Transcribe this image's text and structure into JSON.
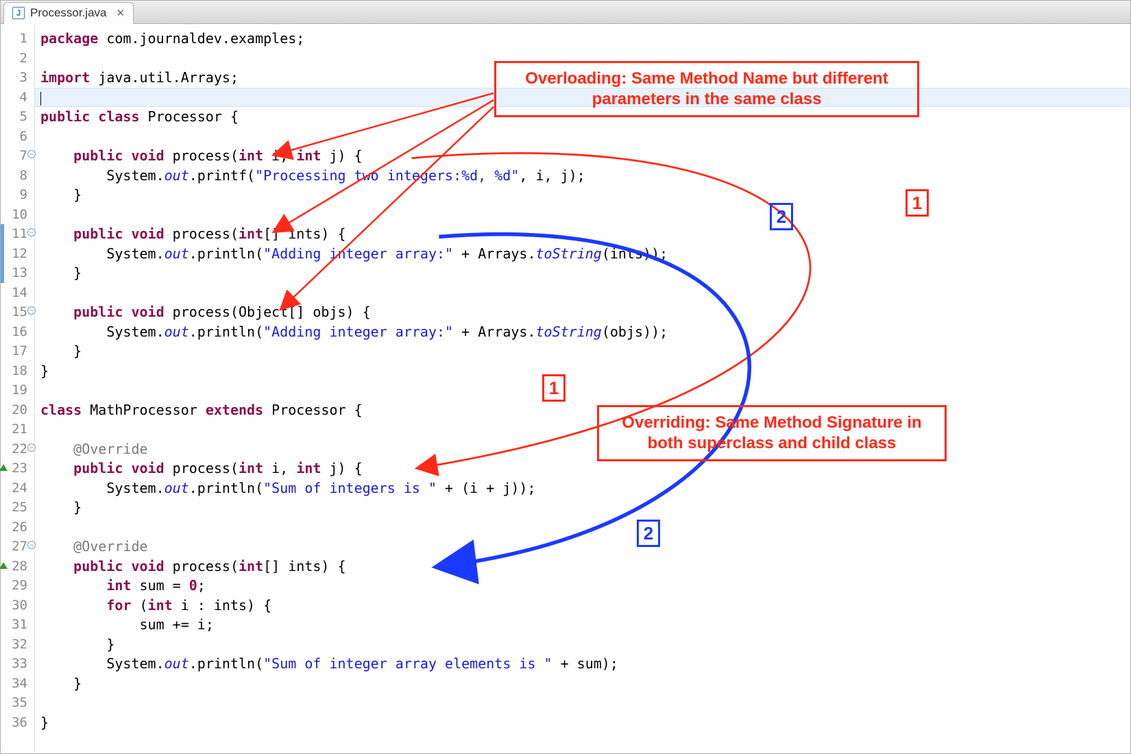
{
  "tab": {
    "filename": "Processor.java",
    "close_glyph": "✕",
    "java_letter": "J"
  },
  "annotations": {
    "overloading": "Overloading: Same Method Name but different\nparameters in the same class",
    "overriding": "Overriding: Same Method Signature in\nboth superclass and child class",
    "red1": "1",
    "red1b": "1",
    "blue2": "2",
    "blue2b": "2"
  },
  "gutter": {
    "line_count": 36,
    "foldable_lines": [
      7,
      11,
      15,
      22,
      27
    ],
    "override_marker_lines": [
      23,
      28
    ],
    "change_marker_lines": [
      11,
      12,
      13
    ],
    "highlighted_line": 4
  },
  "code": [
    {
      "n": 1,
      "h": "<span class='kw'>package</span> com.journaldev.examples;"
    },
    {
      "n": 2,
      "h": ""
    },
    {
      "n": 3,
      "h": "<span class='kw'>import</span> java.util.Arrays;"
    },
    {
      "n": 4,
      "h": "<span class='cur'></span>",
      "hl": true
    },
    {
      "n": 5,
      "h": "<span class='kw'>public</span> <span class='kw'>class</span> Processor {"
    },
    {
      "n": 6,
      "h": ""
    },
    {
      "n": 7,
      "h": "    <span class='kw'>public</span> <span class='kw'>void</span> process(<span class='kw'>int</span> i, <span class='kw'>int</span> j) {"
    },
    {
      "n": 8,
      "h": "        System.<span class='st'>out</span>.printf(<span class='str'>\"Processing two integers:%d, %d\"</span>, i, j);"
    },
    {
      "n": 9,
      "h": "    }"
    },
    {
      "n": 10,
      "h": ""
    },
    {
      "n": 11,
      "h": "    <span class='kw'>public</span> <span class='kw'>void</span> process(<span class='kw'>int</span>[] ints) {"
    },
    {
      "n": 12,
      "h": "        System.<span class='st'>out</span>.println(<span class='str'>\"Adding integer array:\"</span> + Arrays.<span class='st'>toString</span>(ints));"
    },
    {
      "n": 13,
      "h": "    }"
    },
    {
      "n": 14,
      "h": ""
    },
    {
      "n": 15,
      "h": "    <span class='kw'>public</span> <span class='kw'>void</span> process(Object[] objs) {"
    },
    {
      "n": 16,
      "h": "        System.<span class='st'>out</span>.println(<span class='str'>\"Adding integer array:\"</span> + Arrays.<span class='st'>toString</span>(objs));"
    },
    {
      "n": 17,
      "h": "    }"
    },
    {
      "n": 18,
      "h": "}"
    },
    {
      "n": 19,
      "h": ""
    },
    {
      "n": 20,
      "h": "<span class='kw'>class</span> MathProcessor <span class='kw'>extends</span> Processor {"
    },
    {
      "n": 21,
      "h": ""
    },
    {
      "n": 22,
      "h": "    <span class='ann'>@Override</span>"
    },
    {
      "n": 23,
      "h": "    <span class='kw'>public</span> <span class='kw'>void</span> process(<span class='kw'>int</span> i, <span class='kw'>int</span> j) {"
    },
    {
      "n": 24,
      "h": "        System.<span class='st'>out</span>.println(<span class='str'>\"Sum of integers is \"</span> + (i + j));"
    },
    {
      "n": 25,
      "h": "    }"
    },
    {
      "n": 26,
      "h": ""
    },
    {
      "n": 27,
      "h": "    <span class='ann'>@Override</span>"
    },
    {
      "n": 28,
      "h": "    <span class='kw'>public</span> <span class='kw'>void</span> process(<span class='kw'>int</span>[] ints) {"
    },
    {
      "n": 29,
      "h": "        <span class='kw'>int</span> sum = <span class='kw'>0</span>;"
    },
    {
      "n": 30,
      "h": "        <span class='kw'>for</span> (<span class='kw'>int</span> i : ints) {"
    },
    {
      "n": 31,
      "h": "            sum += i;"
    },
    {
      "n": 32,
      "h": "        }"
    },
    {
      "n": 33,
      "h": "        System.<span class='st'>out</span>.println(<span class='str'>\"Sum of integer array elements is \"</span> + sum);"
    },
    {
      "n": 34,
      "h": "    }"
    },
    {
      "n": 35,
      "h": ""
    },
    {
      "n": 36,
      "h": "}"
    }
  ]
}
